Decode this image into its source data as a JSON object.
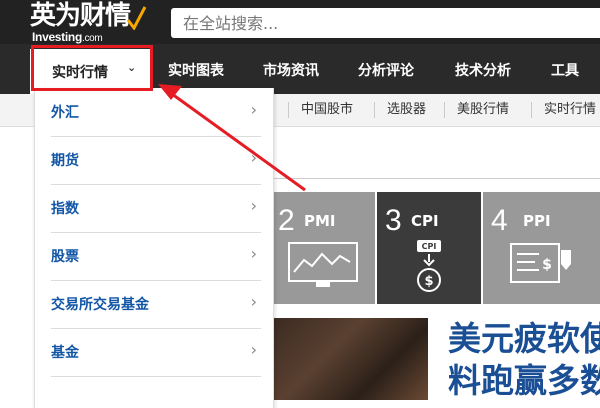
{
  "brand": {
    "logo_zh": "英为财情",
    "logo_en_main": "Investing",
    "logo_en_sub": ".com"
  },
  "search": {
    "placeholder": "在全站搜索..."
  },
  "main_nav": {
    "active_label": "实时行情",
    "items": [
      {
        "label": "实时图表"
      },
      {
        "label": "市场资讯"
      },
      {
        "label": "分析评论"
      },
      {
        "label": "技术分析"
      },
      {
        "label": "工具"
      }
    ]
  },
  "sub_nav": {
    "items": [
      {
        "label": "中国股市"
      },
      {
        "label": "选股器"
      },
      {
        "label": "美股行情"
      },
      {
        "label": "实时行情"
      }
    ]
  },
  "dropdown": {
    "items": [
      {
        "label": "外汇"
      },
      {
        "label": "期货"
      },
      {
        "label": "指数"
      },
      {
        "label": "股票"
      },
      {
        "label": "交易所交易基金"
      },
      {
        "label": "基金"
      }
    ]
  },
  "tiles": [
    {
      "number": "2",
      "label": "PMI"
    },
    {
      "number": "3",
      "label": "CPI"
    },
    {
      "number": "4",
      "label": "PPI"
    }
  ],
  "article": {
    "headline_line1": "美元疲软使",
    "headline_line2": "料跑赢多数"
  },
  "colors": {
    "header_bg": "#222222",
    "nav_bg": "#2a2a2a",
    "accent_red": "#e51c24",
    "link_blue": "#1256a6",
    "headline_blue": "#1b4f95",
    "tile_gray": "#999999",
    "tile_dark": "#3b3b3b"
  }
}
